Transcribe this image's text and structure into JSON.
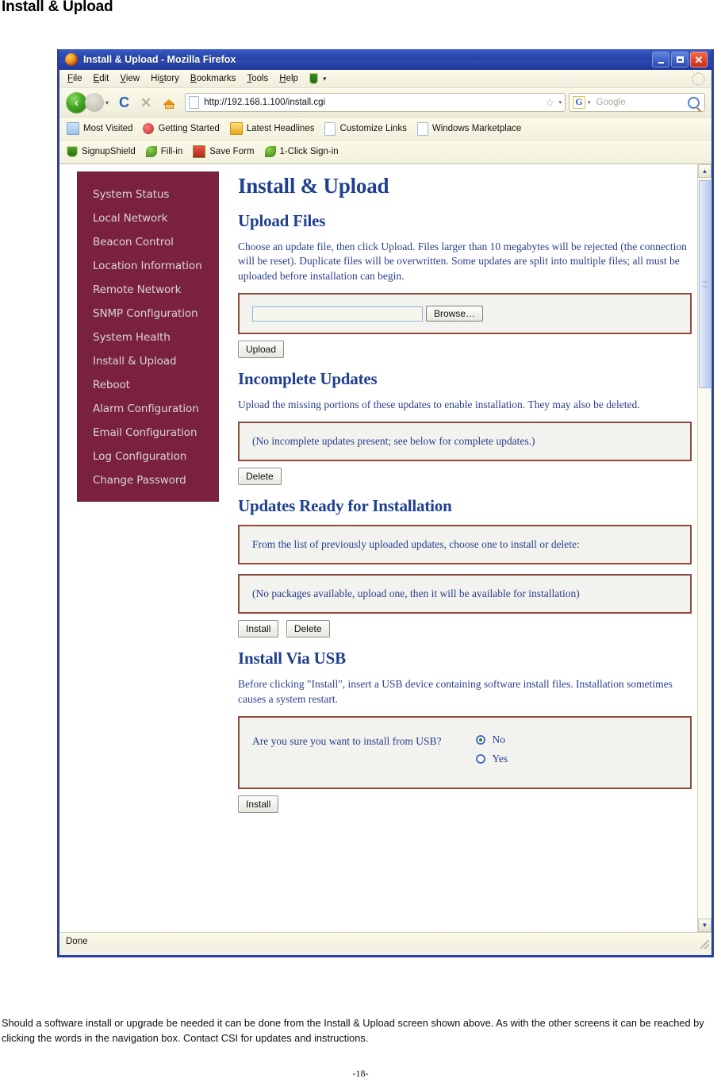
{
  "page": {
    "heading": "Install & Upload",
    "caption": "Should a software install or upgrade be needed it can be done from the Install & Upload screen shown above. As with the other screens it can be reached by clicking the words in the navigation box. Contact CSI for updates and instructions.",
    "page_number": "-18-"
  },
  "browser": {
    "title": "Install & Upload - Mozilla Firefox",
    "window_controls": {
      "minimize": "_",
      "maximize": "□",
      "close": "✕"
    },
    "menu": [
      {
        "label": "File",
        "accel": "F"
      },
      {
        "label": "Edit",
        "accel": "E"
      },
      {
        "label": "View",
        "accel": "V"
      },
      {
        "label": "History",
        "accel": "s"
      },
      {
        "label": "Bookmarks",
        "accel": "B"
      },
      {
        "label": "Tools",
        "accel": "T"
      },
      {
        "label": "Help",
        "accel": "H"
      }
    ],
    "menu_caret": "▾",
    "nav": {
      "back": "‹",
      "forward": "›",
      "history_caret": "▾",
      "reload": "C",
      "stop": "✕",
      "home": "home-icon"
    },
    "url": "http://192.168.1.100/install.cgi",
    "url_caret": "▾",
    "bookmark_star": "☆",
    "search": {
      "engine": "G",
      "engine_caret": "▾",
      "placeholder": "Google"
    },
    "bookmarks_row1": [
      "Most Visited",
      "Getting Started",
      "Latest Headlines",
      "Customize Links",
      "Windows Marketplace"
    ],
    "bookmarks_row2": [
      "SignupShield",
      "Fill-in",
      "Save Form",
      "1-Click Sign-in"
    ],
    "status": "Done",
    "scrollbar": {
      "up_arrow": "▲",
      "down_arrow": "▼"
    }
  },
  "webpage": {
    "nav_items": [
      "System Status",
      "Local Network",
      "Beacon Control",
      "Location Information",
      "Remote Network",
      "SNMP Configuration",
      "System Health",
      "Install & Upload",
      "Reboot",
      "Alarm Configuration",
      "Email Configuration",
      "Log Configuration",
      "Change Password"
    ],
    "title": "Install & Upload",
    "upload_files": {
      "heading": "Upload Files",
      "description": "Choose an update file, then click Upload. Files larger than 10 megabytes will be rejected (the connection will be reset). Duplicate files will be overwritten. Some updates are split into multiple files; all must be uploaded before installation can begin.",
      "file_value": "",
      "browse_label": "Browse…",
      "upload_label": "Upload"
    },
    "incomplete_updates": {
      "heading": "Incomplete Updates",
      "description": "Upload the missing portions of these updates to enable installation.  They may also be deleted.",
      "empty_message": "(No incomplete updates present; see below for complete updates.)",
      "delete_label": "Delete"
    },
    "updates_ready": {
      "heading": "Updates Ready for Installation",
      "instruction": "From the list of previously uploaded updates, choose one to install or delete:",
      "empty_message": "(No packages available, upload one, then it will be available for installation)",
      "install_label": "Install",
      "delete_label": "Delete"
    },
    "install_usb": {
      "heading": "Install Via USB",
      "description": "Before clicking \"Install\", insert a USB device containing software install files.  Installation sometimes causes a system restart.",
      "question": "Are you sure you want to install from USB?",
      "options": [
        {
          "label": "No",
          "selected": true
        },
        {
          "label": "Yes",
          "selected": false
        }
      ],
      "install_label": "Install"
    }
  },
  "colors": {
    "nav_box_bg": "#7b2140",
    "nav_link": "#d8d4d6",
    "heading_blue": "#1f3f8f",
    "body_blue": "#2a3f8c",
    "panel_border": "#8f4a3a",
    "titlebar_blue": "#23409f"
  }
}
